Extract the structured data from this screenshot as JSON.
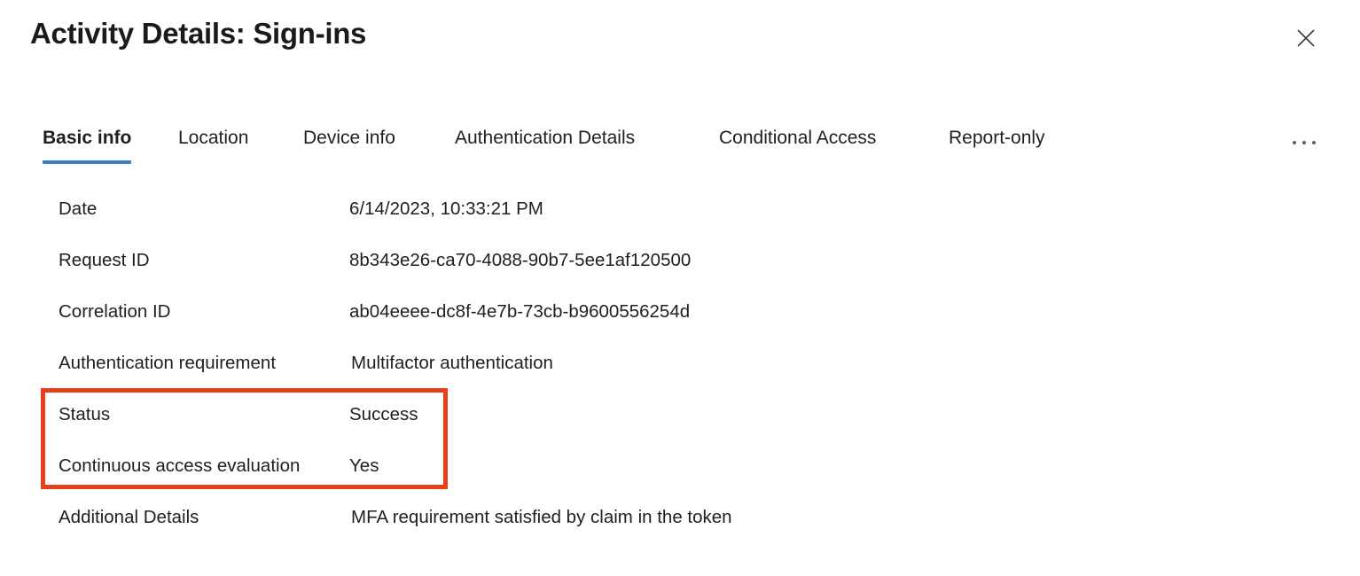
{
  "header": {
    "title": "Activity Details: Sign-ins",
    "close_icon": "close-icon",
    "close_label": "Close"
  },
  "tabs": {
    "items": [
      {
        "label": "Basic info",
        "active": true
      },
      {
        "label": "Location",
        "active": false
      },
      {
        "label": "Device info",
        "active": false
      },
      {
        "label": "Authentication Details",
        "active": false
      },
      {
        "label": "Conditional Access",
        "active": false
      },
      {
        "label": "Report-only",
        "active": false
      }
    ],
    "overflow_icon": "ellipsis-icon",
    "overflow_label": "More tabs"
  },
  "details": {
    "rows": [
      {
        "label": "Date",
        "value": "6/14/2023, 10:33:21 PM"
      },
      {
        "label": "Request ID",
        "value": "8b343e26-ca70-4088-90b7-5ee1af120500"
      },
      {
        "label": "Correlation ID",
        "value": "ab04eeee-dc8f-4e7b-73cb-b9600556254d"
      },
      {
        "label": "Authentication requirement",
        "value": "Multifactor authentication"
      },
      {
        "label": "Status",
        "value": "Success"
      },
      {
        "label": "Continuous access evaluation",
        "value": "Yes"
      },
      {
        "label": "Additional Details",
        "value": "MFA requirement satisfied by claim in the token"
      }
    ]
  },
  "annotation": {
    "highlight_color": "#e8401c",
    "highlighted_rows": [
      "Status",
      "Continuous access evaluation"
    ]
  },
  "colors": {
    "accent_blue": "#4178c8",
    "text": "#201f1e",
    "background": "#ffffff",
    "annotation_red": "#e8401c"
  }
}
